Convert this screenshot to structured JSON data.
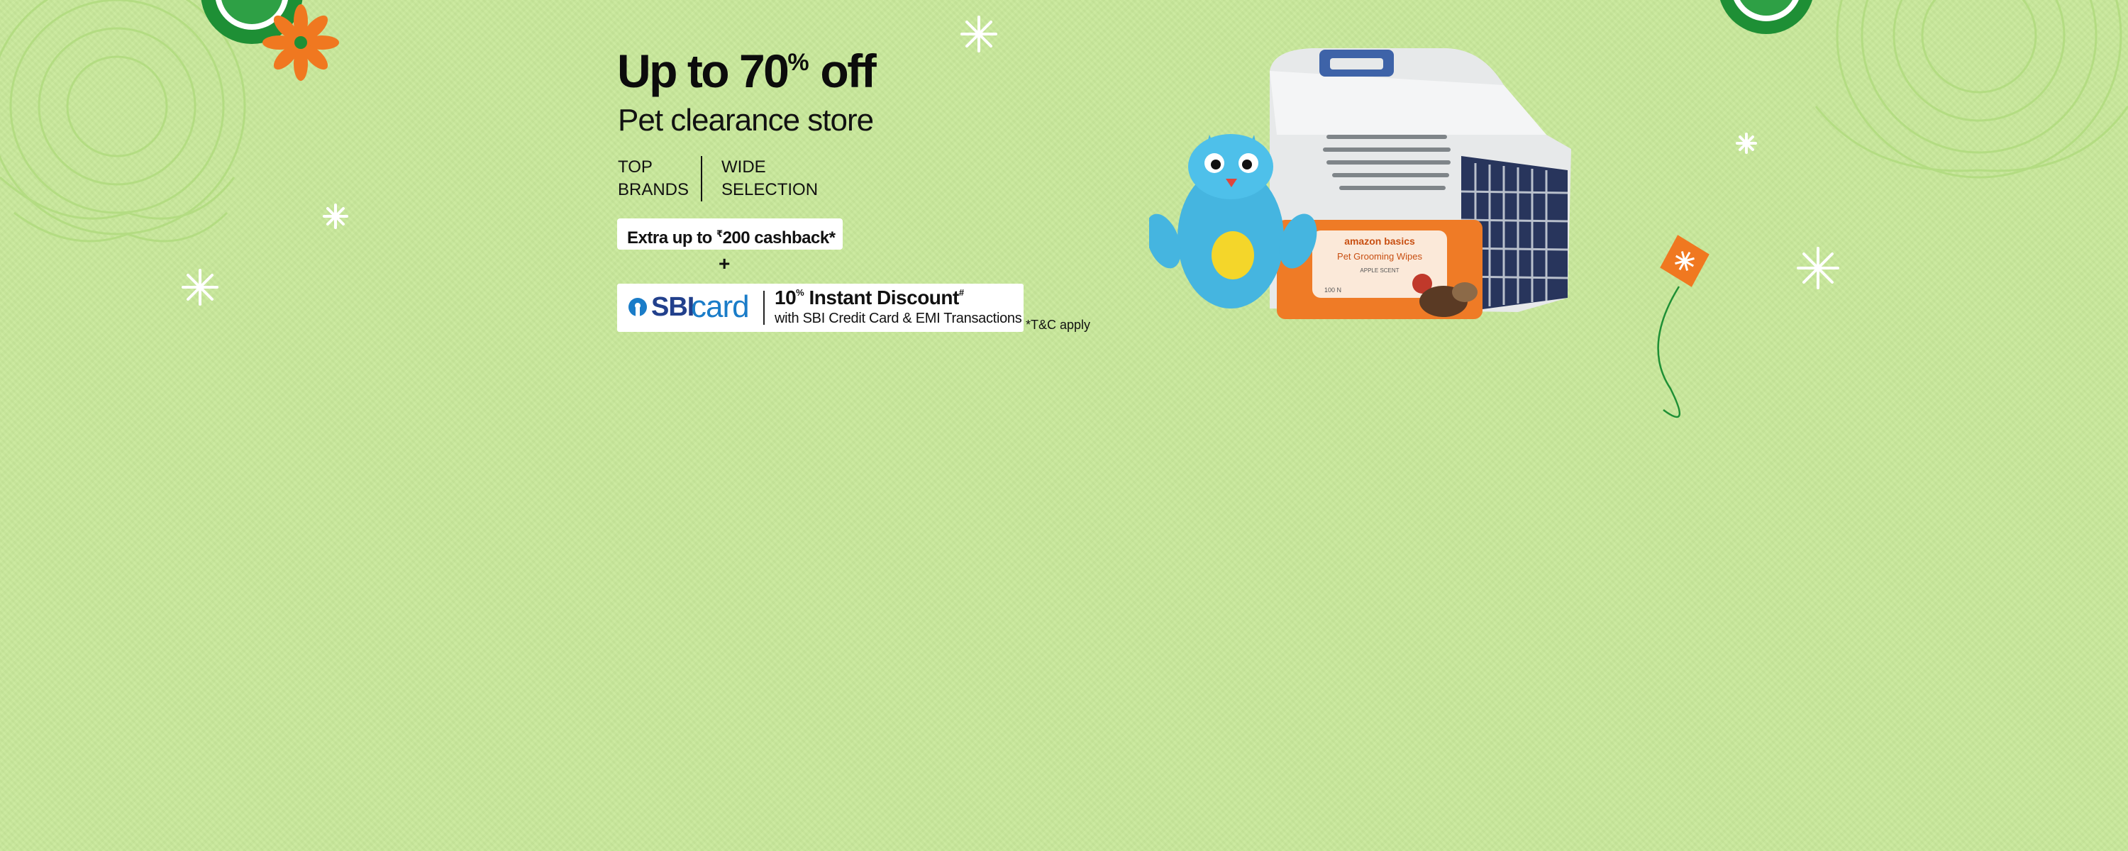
{
  "banner": {
    "headline_pre": "Up to 70",
    "headline_pct": "%",
    "headline_post": " off",
    "subhead": "Pet clearance store",
    "features": [
      "TOP\nBRANDS",
      "WIDE\nSELECTION"
    ],
    "cashback_pre": "Extra up to ",
    "cashback_rupee": "₹",
    "cashback_post": "200 cashback*",
    "plus": "+",
    "sbi": {
      "logo_sbi": "SBI",
      "logo_card": "card",
      "offer_pre": "10",
      "offer_pct": "%",
      "offer_post": " Instant Discount",
      "offer_hash": "#",
      "sub": "with SBI Credit Card & EMI Transactions"
    },
    "tnc": "*T&C apply"
  },
  "products": {
    "wipes_brand": "amazon basics",
    "wipes_name": "Pet Grooming Wipes",
    "wipes_scent": "APPLE SCENT",
    "wipes_count": "100 N"
  },
  "colors": {
    "background": "#c8e89a",
    "sbi_blue": "#1a7cc8",
    "sbi_navy": "#22408c",
    "kite_orange": "#f07820",
    "rangoli_green": "#178a2e"
  }
}
